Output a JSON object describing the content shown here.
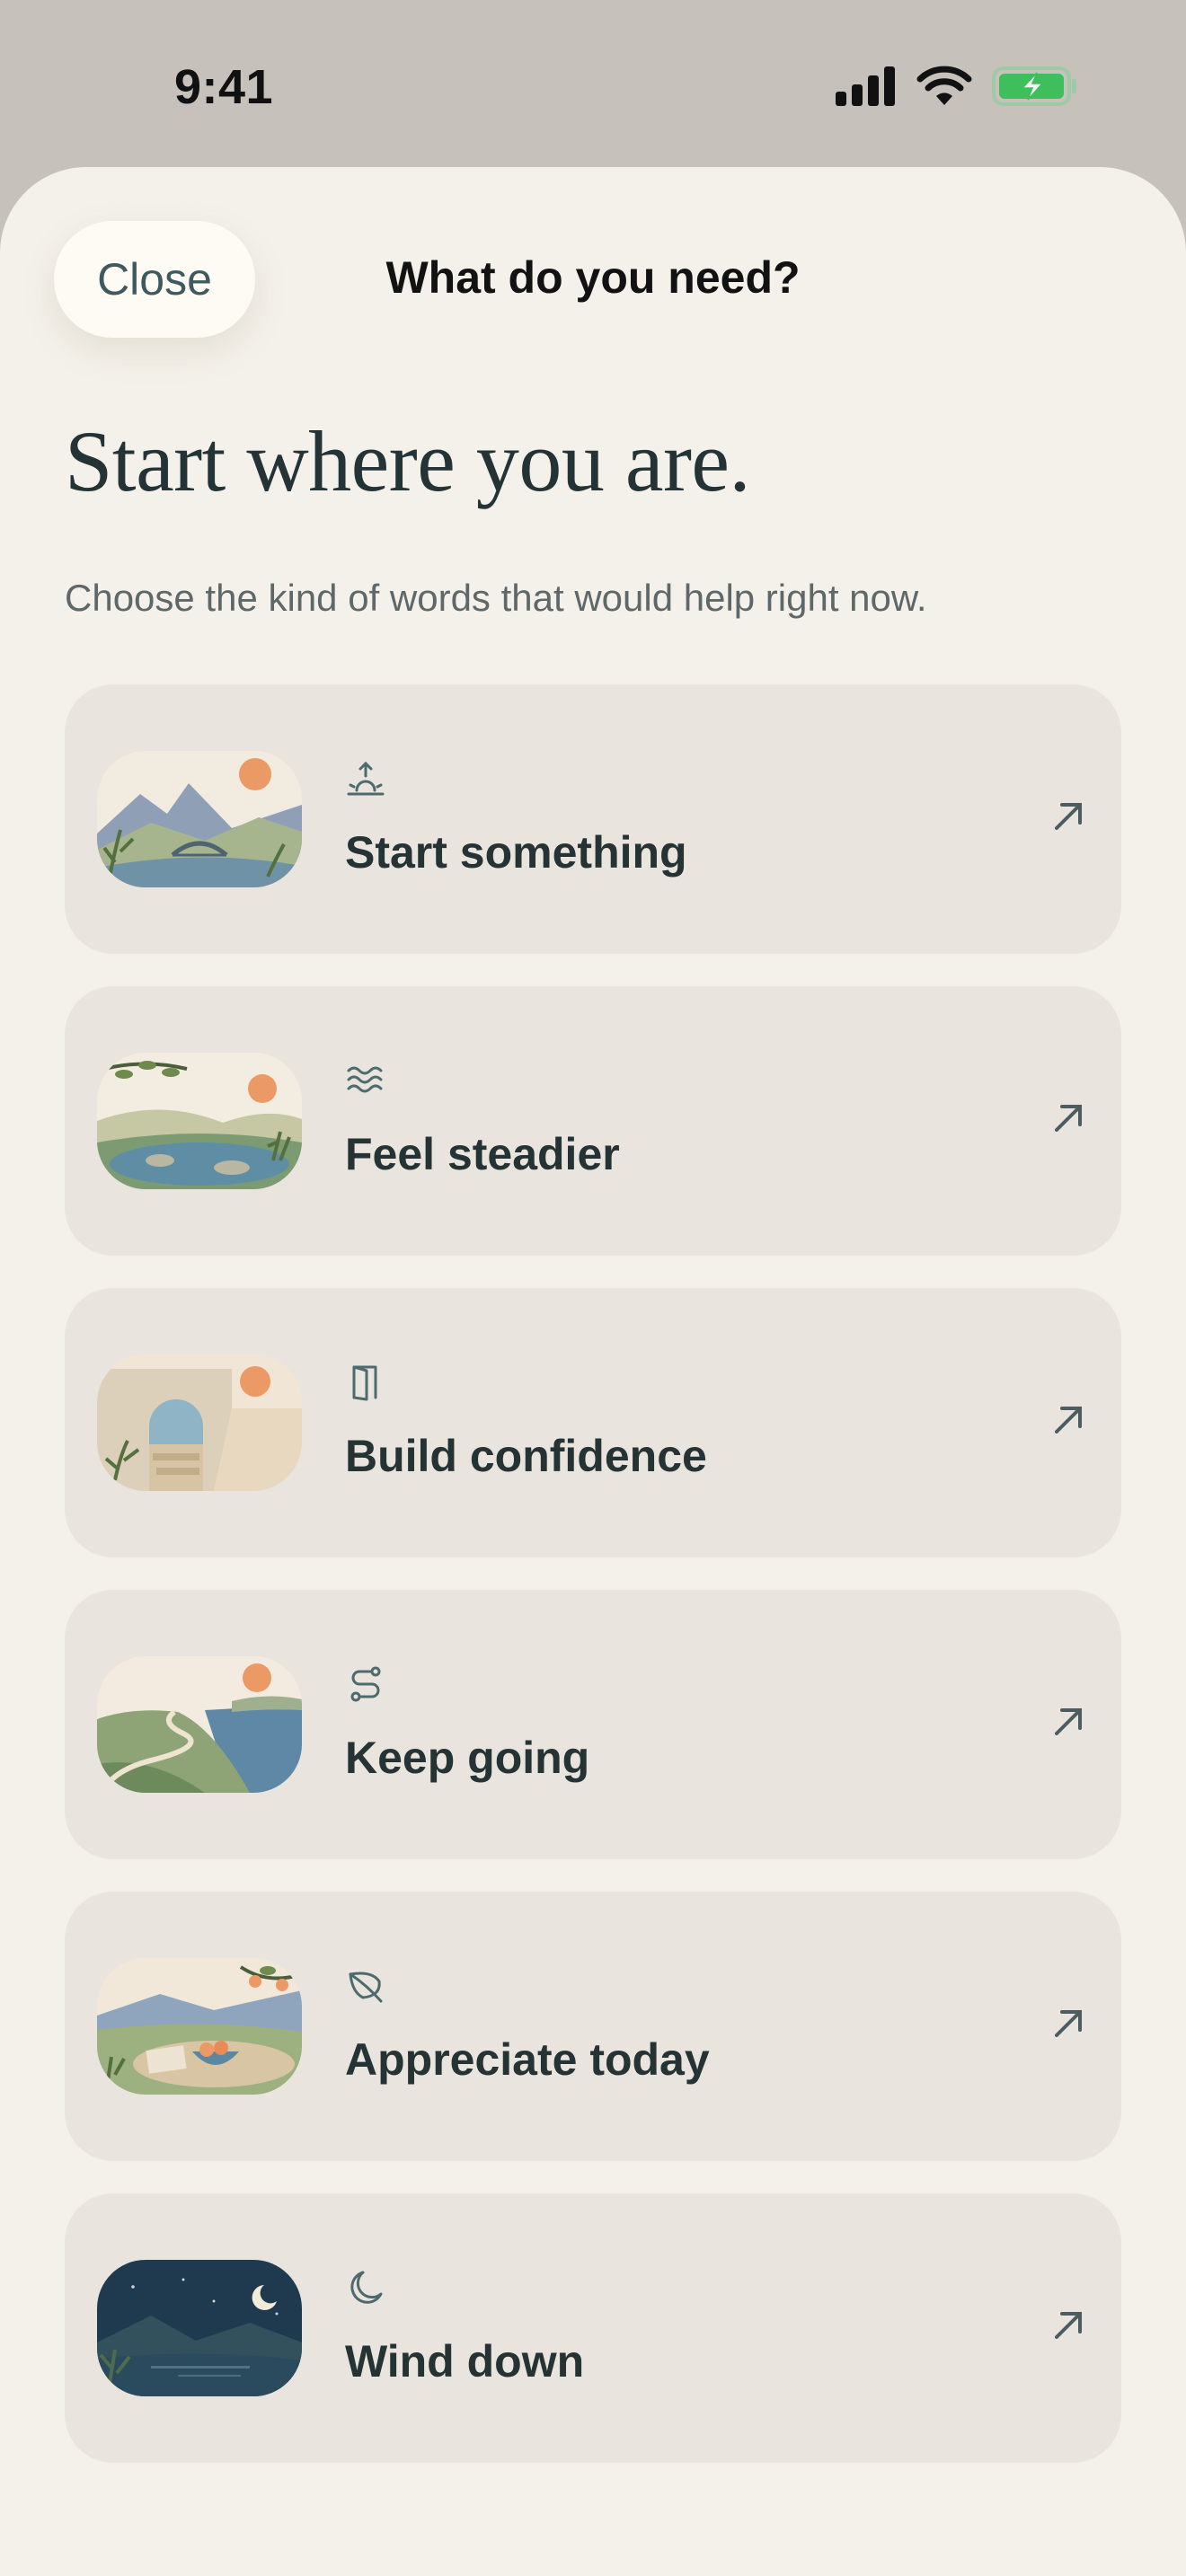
{
  "status_bar": {
    "time": "9:41",
    "icons": [
      "signal-icon",
      "wifi-icon",
      "battery-charging-icon"
    ],
    "battery_color": "#3fbf5b"
  },
  "header": {
    "close_label": "Close",
    "title": "What do you need?"
  },
  "headline": "Start where you are.",
  "subtitle": "Choose the kind of words that would help right now.",
  "options": [
    {
      "label": "Start something",
      "icon": "sunrise-icon",
      "thumbnail": "mountain-bridge-sunrise-illustration"
    },
    {
      "label": "Feel steadier",
      "icon": "waves-icon",
      "thumbnail": "calm-pond-branch-illustration"
    },
    {
      "label": "Build confidence",
      "icon": "door-icon",
      "thumbnail": "stone-arch-sea-illustration"
    },
    {
      "label": "Keep going",
      "icon": "path-icon",
      "thumbnail": "coastal-path-illustration"
    },
    {
      "label": "Appreciate today",
      "icon": "leaf-icon",
      "thumbnail": "fruit-bowl-table-illustration"
    },
    {
      "label": "Wind down",
      "icon": "moon-icon",
      "thumbnail": "night-lake-moon-illustration"
    }
  ],
  "colors": {
    "sheet_background": "#f4f1ea",
    "card_background": "#e9e5de",
    "text_primary": "#253335",
    "accent_sun": "#ec9a65"
  }
}
